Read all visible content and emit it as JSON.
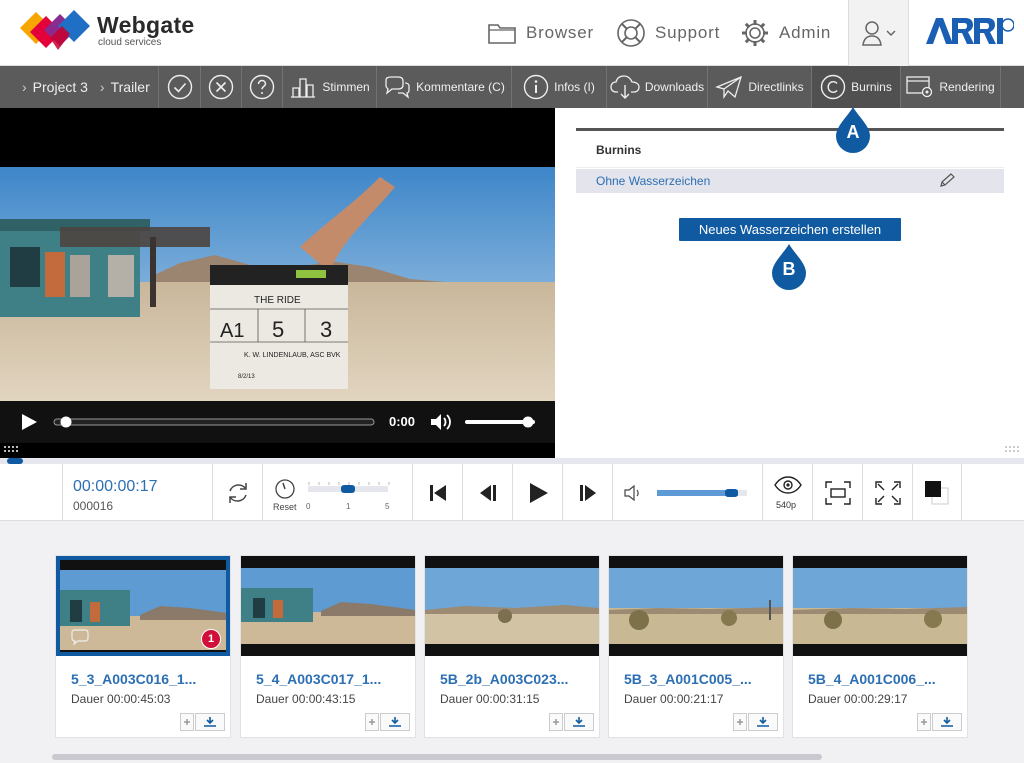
{
  "app": {
    "title": "Webgate",
    "subtitle": "cloud services"
  },
  "topnav": {
    "browser": "Browser",
    "support": "Support",
    "admin": "Admin"
  },
  "breadcrumb": {
    "project": "Project 3",
    "item": "Trailer"
  },
  "toolbar": {
    "stimmen": "Stimmen",
    "kommentare": "Kommentare (C)",
    "infos": "Infos (I)",
    "downloads": "Downloads",
    "directlinks": "Directlinks",
    "burnins": "Burnins",
    "rendering": "Rendering"
  },
  "video": {
    "time": "0:00",
    "slate_title": "THE RIDE",
    "roll": "A1",
    "scene": "5",
    "take": "3",
    "director": "K. W. LINDENLAUB, ASC BVK",
    "date": "8/2/13"
  },
  "burnins_panel": {
    "title": "Burnins",
    "items": [
      {
        "label": "Ohne Wasserzeichen"
      }
    ],
    "new_button": "Neues Wasserzeichen erstellen"
  },
  "markers": {
    "a": "A",
    "b": "B"
  },
  "player": {
    "timecode": "00:00:00:17",
    "frame": "000016",
    "reset_label": "Reset",
    "speed_ticks": [
      "0",
      "1",
      "5"
    ],
    "speed": 1,
    "volume": 0.9,
    "quality": "540p"
  },
  "clips": [
    {
      "name": "5_3_A003C016_1...",
      "duration": "Dauer 00:00:45:03",
      "badge": "1",
      "active": true
    },
    {
      "name": "5_4_A003C017_1...",
      "duration": "Dauer 00:00:43:15"
    },
    {
      "name": "5B_2b_A003C023...",
      "duration": "Dauer 00:00:31:15"
    },
    {
      "name": "5B_3_A001C005_...",
      "duration": "Dauer 00:00:21:17"
    },
    {
      "name": "5B_4_A001C006_...",
      "duration": "Dauer 00:00:29:17"
    }
  ],
  "colors": {
    "accent": "#0f5aa1",
    "toolbar": "#5b5b5b",
    "badge": "#d0103a",
    "link": "#2c6fb3"
  }
}
